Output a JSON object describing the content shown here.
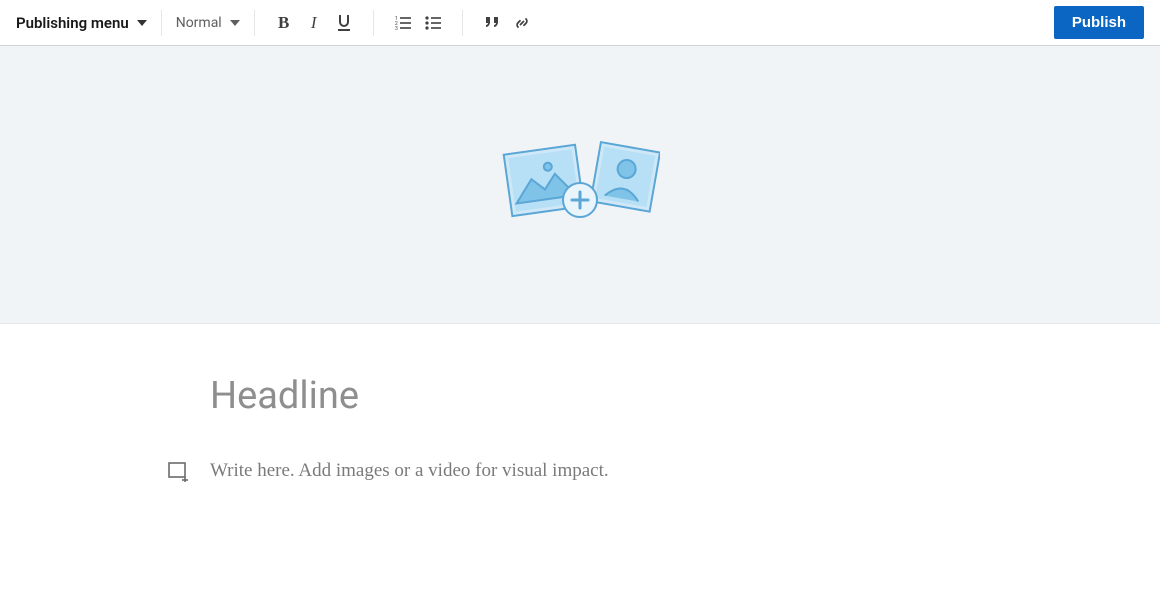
{
  "toolbar": {
    "publishing_menu_label": "Publishing menu",
    "style_label": "Normal",
    "publish_label": "Publish"
  },
  "editor": {
    "headline_placeholder": "Headline",
    "body_placeholder": "Write here. Add images or a video for visual impact."
  }
}
